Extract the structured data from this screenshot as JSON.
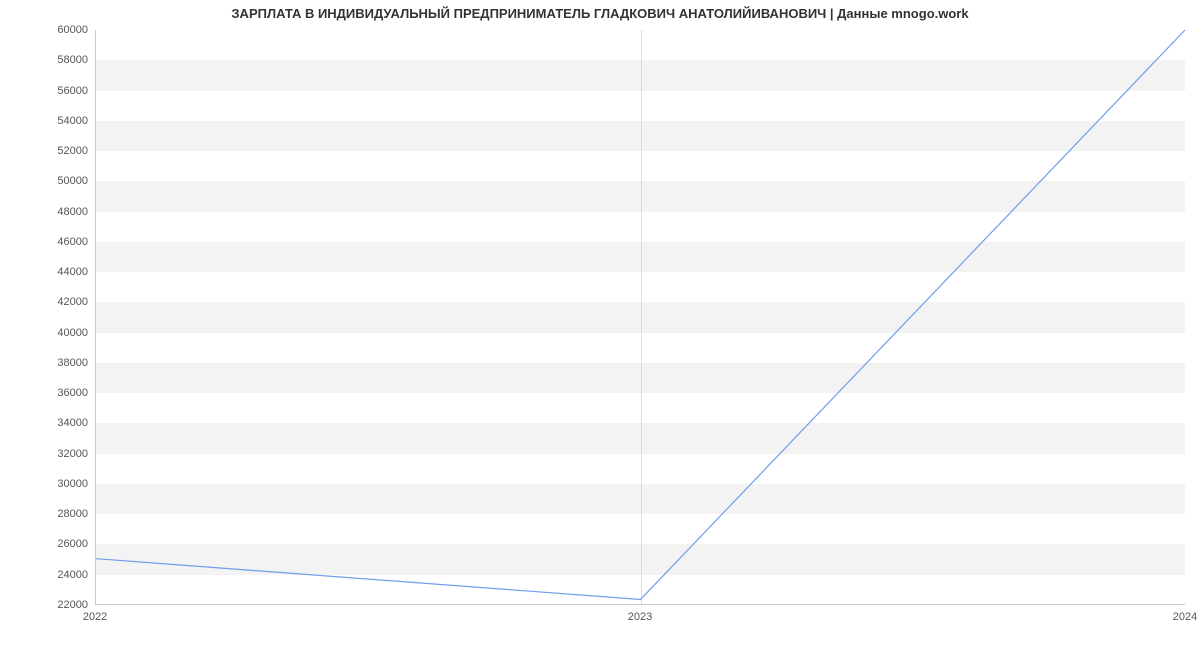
{
  "chart_data": {
    "type": "line",
    "title": "ЗАРПЛАТА В ИНДИВИДУАЛЬНЫЙ ПРЕДПРИНИМАТЕЛЬ ГЛАДКОВИЧ АНАТОЛИЙИВАНОВИЧ | Данные mnogo.work",
    "xlabel": "",
    "ylabel": "",
    "x": [
      2022,
      2023,
      2024
    ],
    "x_ticks": [
      2022,
      2023,
      2024
    ],
    "y_ticks": [
      22000,
      24000,
      26000,
      28000,
      30000,
      32000,
      34000,
      36000,
      38000,
      40000,
      42000,
      44000,
      46000,
      48000,
      50000,
      52000,
      54000,
      56000,
      58000,
      60000
    ],
    "ylim": [
      22000,
      60000
    ],
    "xlim": [
      2022,
      2024
    ],
    "series": [
      {
        "name": "salary",
        "values": [
          25000,
          22300,
          60000
        ]
      }
    ],
    "line_color": "#6f9fe8",
    "grid": true
  }
}
